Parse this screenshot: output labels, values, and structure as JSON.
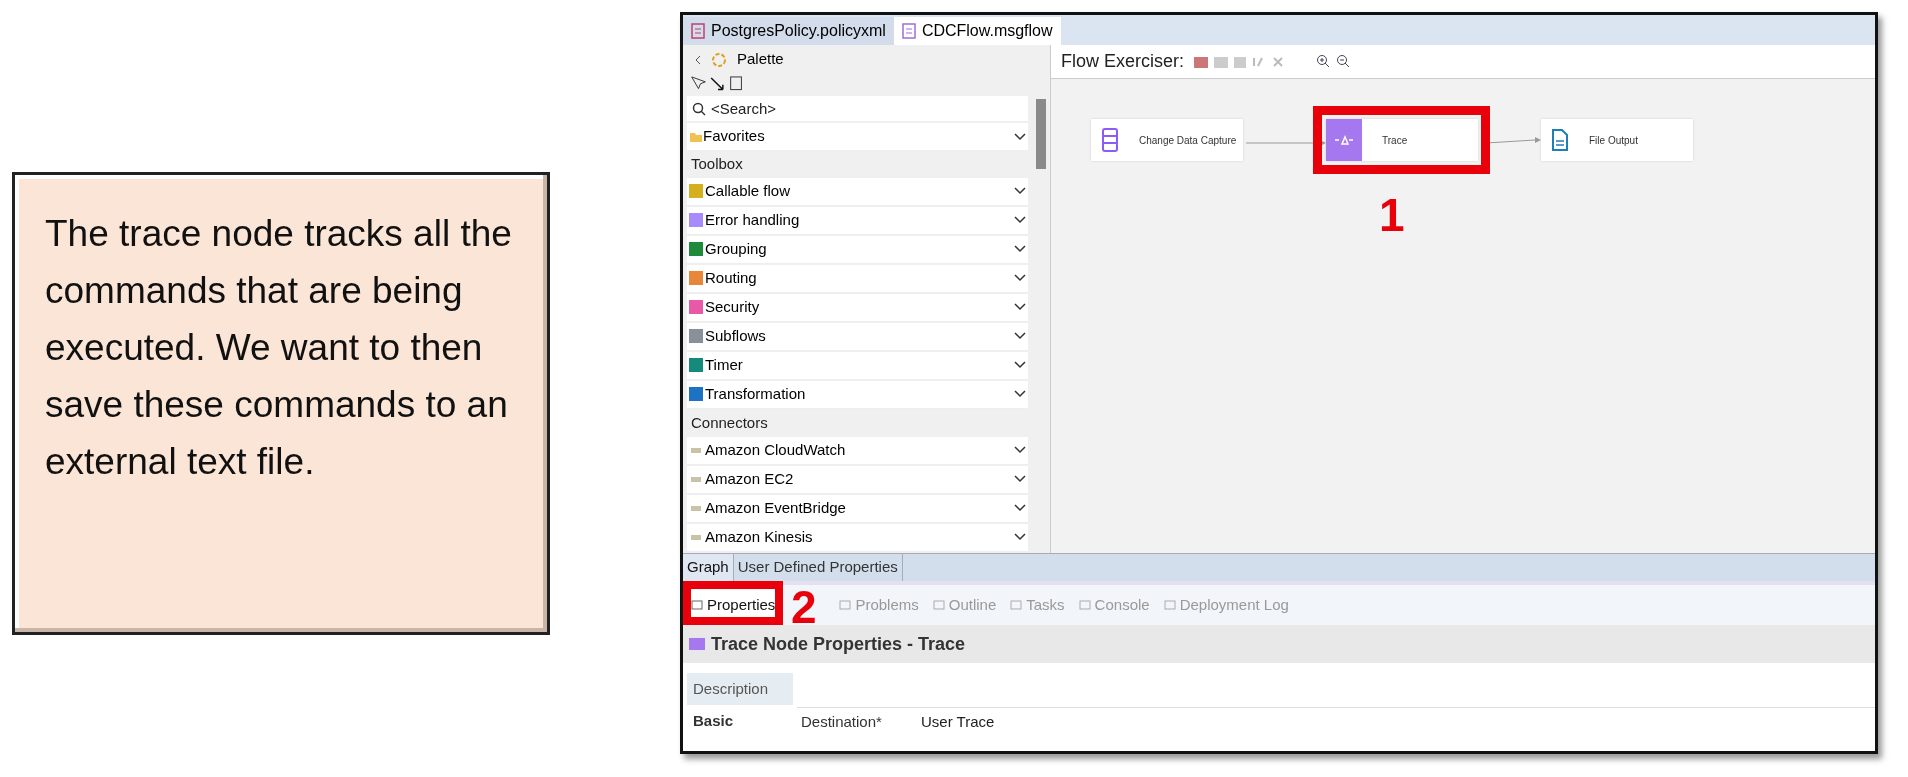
{
  "callout": {
    "text": "The trace node tracks all the commands that are being executed. We want to then save these commands to an external text file."
  },
  "editor_tabs": [
    {
      "label": "PostgresPolicy.policyxml",
      "selected": false
    },
    {
      "label": "CDCFlow.msgflow",
      "selected": true
    }
  ],
  "palette": {
    "title": "Palette",
    "search": {
      "placeholder": "<Search>"
    },
    "favorites": "Favorites",
    "sections": [
      {
        "title": "Toolbox",
        "items": [
          {
            "label": "Callable flow",
            "color": "#d4b020"
          },
          {
            "label": "Error handling",
            "color": "#a78bfa"
          },
          {
            "label": "Grouping",
            "color": "#1f8a3a"
          },
          {
            "label": "Routing",
            "color": "#e8863a"
          },
          {
            "label": "Security",
            "color": "#e85aa8"
          },
          {
            "label": "Subflows",
            "color": "#8a9099"
          },
          {
            "label": "Timer",
            "color": "#138a7a"
          },
          {
            "label": "Transformation",
            "color": "#1d72c4"
          }
        ]
      },
      {
        "title": "Connectors",
        "items": [
          {
            "label": "Amazon CloudWatch",
            "color": "#c8c2a8"
          },
          {
            "label": "Amazon EC2",
            "color": "#c8c2a8"
          },
          {
            "label": "Amazon EventBridge",
            "color": "#c8c2a8"
          },
          {
            "label": "Amazon Kinesis",
            "color": "#c8c2a8"
          }
        ]
      }
    ]
  },
  "flow_exerciser": {
    "label": "Flow Exerciser:"
  },
  "nodes": [
    {
      "label": "Change Data Capture",
      "kind": "database",
      "highlighted": false
    },
    {
      "label": "Trace",
      "kind": "trace",
      "highlighted": true
    },
    {
      "label": "File Output",
      "kind": "file",
      "highlighted": false
    }
  ],
  "annotations": [
    {
      "number": "1"
    },
    {
      "number": "2"
    }
  ],
  "bottom_tabs": [
    {
      "label": "Graph",
      "selected": true
    },
    {
      "label": "User Defined Properties",
      "selected": false
    }
  ],
  "views": [
    {
      "label": "Properties",
      "selected": true
    },
    {
      "label": "Problems",
      "selected": false
    },
    {
      "label": "Outline",
      "selected": false
    },
    {
      "label": "Tasks",
      "selected": false
    },
    {
      "label": "Console",
      "selected": false
    },
    {
      "label": "Deployment Log",
      "selected": false
    }
  ],
  "properties": {
    "title": "Trace Node Properties - Trace",
    "sections": [
      {
        "label": "Description",
        "selected": false
      },
      {
        "label": "Basic",
        "selected": true
      }
    ],
    "fields": [
      {
        "label": "Destination*",
        "value": "User Trace"
      }
    ]
  }
}
